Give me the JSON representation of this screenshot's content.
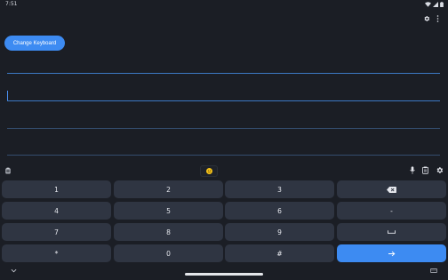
{
  "status": {
    "time": "7:51"
  },
  "actions": {
    "change_keyboard": "Change Keyboard"
  },
  "colors": {
    "accent": "#3d8bf2",
    "key_bg": "#2f3542",
    "background": "#1b1e25",
    "emoji": "#f4c21a"
  },
  "toolbar": {
    "left_icon": "clipboard-clear-icon",
    "center_icon": "emoji-icon",
    "right_icons": [
      "microphone-icon",
      "clipboard-icon",
      "settings-icon"
    ]
  },
  "keyboard": {
    "rows": [
      [
        "1",
        "2",
        "3",
        "⌫"
      ],
      [
        "4",
        "5",
        "6",
        "-"
      ],
      [
        "7",
        "8",
        "9",
        "␣"
      ],
      [
        "*",
        "0",
        "#",
        "→"
      ]
    ]
  }
}
